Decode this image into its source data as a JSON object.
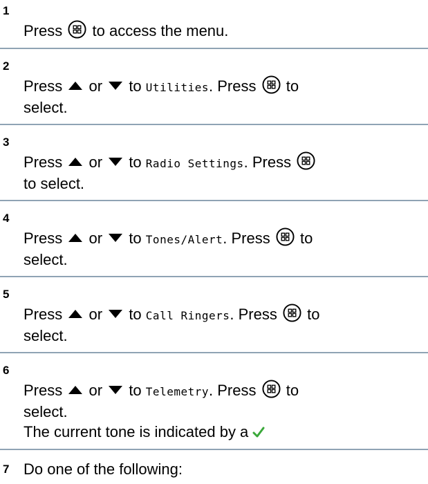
{
  "steps": [
    {
      "num": "1",
      "press": "Press",
      "rest": "to access the menu."
    },
    {
      "num": "2",
      "press": "Press",
      "or": "or",
      "to": "to",
      "target": "Utilities",
      "sep": ". Press",
      "tail": "to",
      "line2": "select."
    },
    {
      "num": "3",
      "press": "Press",
      "or": "or",
      "to": "to",
      "target": "Radio Settings",
      "sep": ". Press",
      "line2": "to select."
    },
    {
      "num": "4",
      "press": "Press",
      "or": "or",
      "to": "to",
      "target": "Tones/Alert",
      "sep": ". Press",
      "tail": "to",
      "line2": "select."
    },
    {
      "num": "5",
      "press": "Press",
      "or": "or",
      "to": "to",
      "target": "Call Ringers",
      "sep": ". Press",
      "tail": "to",
      "line2": "select."
    },
    {
      "num": "6",
      "press": "Press",
      "or": "or",
      "to": "to",
      "target": "Telemetry",
      "sep": ". Press",
      "tail": "to",
      "line2": "select.",
      "line3": "The current tone is indicated by a"
    },
    {
      "num": "7",
      "text": "Do one of the following:"
    }
  ],
  "colors": {
    "divider": "#8fa3b4",
    "check": "#3aa83a"
  },
  "icons": {
    "menu": "menu-ok-button-icon",
    "up": "up-arrow-icon",
    "down": "down-arrow-icon",
    "check": "checkmark-icon"
  }
}
